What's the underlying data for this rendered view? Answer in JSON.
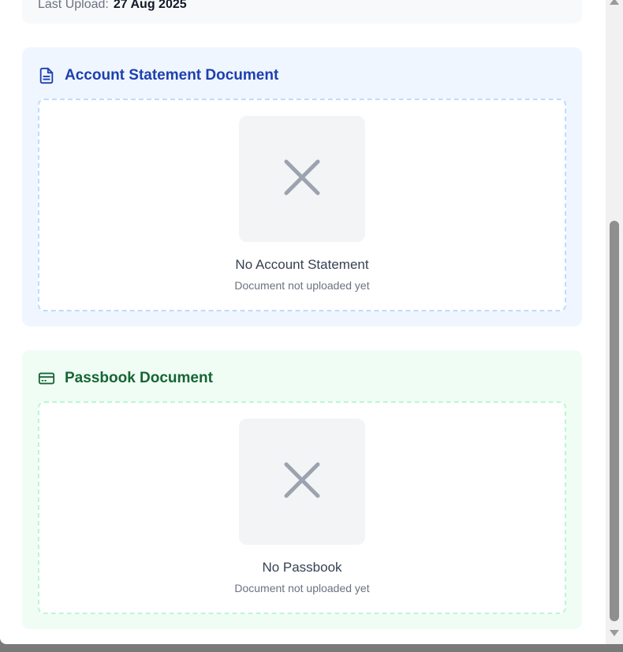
{
  "upload_info": {
    "label": "Last Upload:",
    "value": "27 Aug 2025"
  },
  "account_statement": {
    "title": "Account Statement Document",
    "icon": "document-icon",
    "empty_title": "No Account Statement",
    "empty_subtitle": "Document not uploaded yet",
    "accent": "#1e40af",
    "background": "#eff6ff"
  },
  "passbook": {
    "title": "Passbook Document",
    "icon": "card-icon",
    "empty_title": "No Passbook",
    "empty_subtitle": "Document not uploaded yet",
    "accent": "#166534",
    "background": "#f0fdf4"
  }
}
